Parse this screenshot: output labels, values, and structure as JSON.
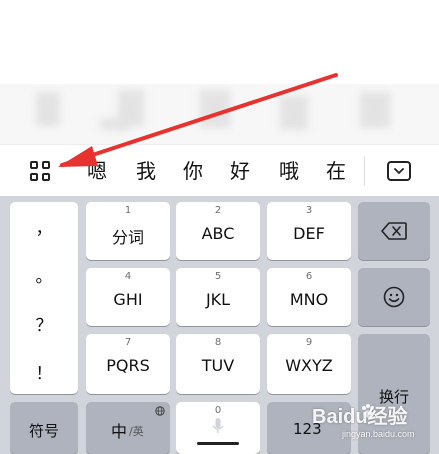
{
  "candidate_bar": {
    "words": [
      "嗯",
      "我",
      "你",
      "好",
      "哦",
      "在"
    ]
  },
  "keyboard": {
    "punctuation": [
      "，",
      "。",
      "？",
      "！"
    ],
    "keys": [
      {
        "num": "1",
        "label": "分词"
      },
      {
        "num": "2",
        "label": "ABC"
      },
      {
        "num": "3",
        "label": "DEF"
      },
      {
        "num": "4",
        "label": "GHI"
      },
      {
        "num": "5",
        "label": "JKL"
      },
      {
        "num": "6",
        "label": "MNO"
      },
      {
        "num": "7",
        "label": "PQRS"
      },
      {
        "num": "8",
        "label": "TUV"
      },
      {
        "num": "9",
        "label": "WXYZ"
      }
    ],
    "newline_label": "换行",
    "symbol_label": "符号",
    "lang_main": "中",
    "lang_sub": "/英",
    "zero_num": "0",
    "digits_label": "123"
  },
  "colors": {
    "keyboard_bg": "#d1d4da",
    "key_bg": "#ffffff",
    "key_dark_bg": "#aeb3be",
    "arrow": "#e8322f"
  },
  "watermark": {
    "main": "Baidu经验",
    "url": "jingyan.baidu.com"
  }
}
